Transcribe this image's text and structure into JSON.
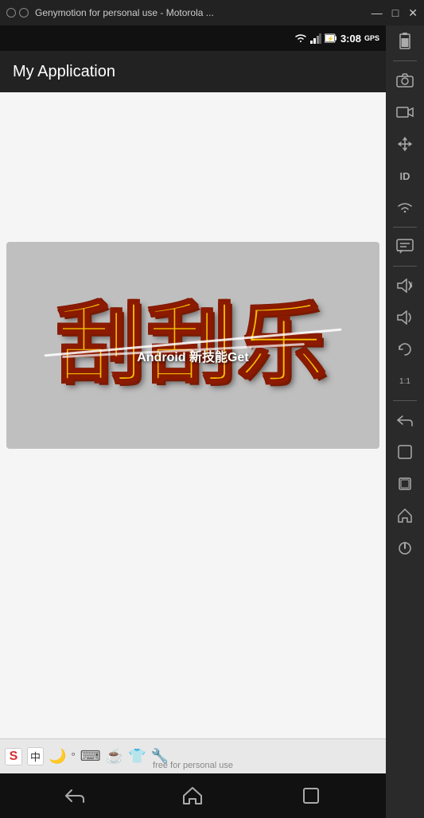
{
  "titlebar": {
    "text": "Genymotion for personal use - Motorola ...",
    "minimize": "—",
    "maximize": "□",
    "close": "✕"
  },
  "statusbar": {
    "time": "3:08",
    "wifi_icon": "wifi",
    "signal_icon": "signal",
    "battery_icon": "battery",
    "gps_label": "GPS"
  },
  "appbar": {
    "title": "My Application"
  },
  "image": {
    "chinese_chars": "刮刮乐",
    "overlay_text": "Android 新技能Get"
  },
  "keyboard": {
    "icons": [
      "S",
      "中",
      "🌙",
      "°",
      "⌨",
      "☕",
      "👕",
      "🔧"
    ]
  },
  "navbar": {
    "back_label": "back",
    "home_label": "home",
    "recents_label": "recents"
  },
  "watermark": {
    "text": "free for personal use"
  },
  "sidebar": {
    "icons": [
      {
        "name": "battery-icon",
        "symbol": "🔋"
      },
      {
        "name": "camera-icon",
        "symbol": "📷"
      },
      {
        "name": "video-icon",
        "symbol": "🎬"
      },
      {
        "name": "move-icon",
        "symbol": "✛"
      },
      {
        "name": "id-icon",
        "symbol": "ID"
      },
      {
        "name": "wifi-icon",
        "symbol": "📶"
      },
      {
        "name": "chat-icon",
        "symbol": "💬"
      },
      {
        "name": "volume-up-icon",
        "symbol": "🔊"
      },
      {
        "name": "volume-down-icon",
        "symbol": "🔉"
      },
      {
        "name": "rotate-icon",
        "symbol": "⟳"
      },
      {
        "name": "scale-icon",
        "symbol": "⊞"
      },
      {
        "name": "back-nav-icon",
        "symbol": "↩"
      },
      {
        "name": "recents-nav-icon",
        "symbol": "⬜"
      },
      {
        "name": "menu-nav-icon",
        "symbol": "▣"
      },
      {
        "name": "home-nav-icon",
        "symbol": "⌂"
      },
      {
        "name": "power-icon",
        "symbol": "⏻"
      }
    ]
  }
}
